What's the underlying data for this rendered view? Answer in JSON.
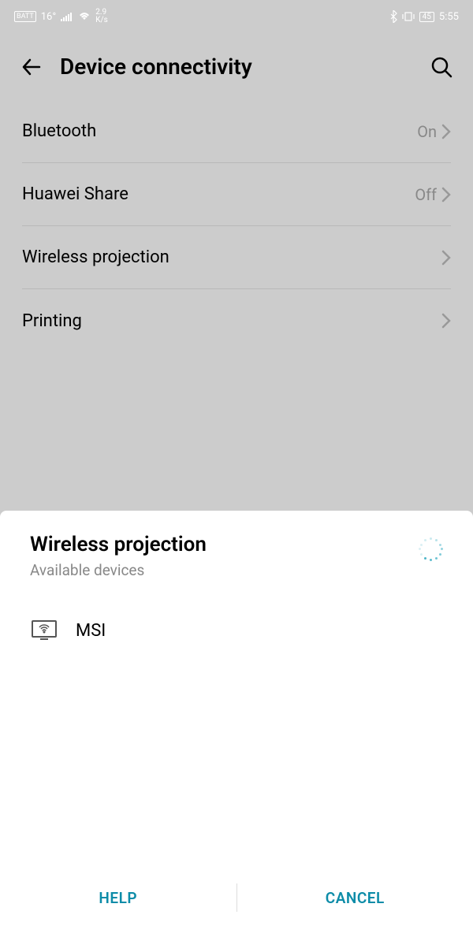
{
  "status": {
    "temp": "16°",
    "speed_top": "2.9",
    "speed_unit": "K/s",
    "battery": "45",
    "time": "5:55"
  },
  "header": {
    "title": "Device connectivity"
  },
  "settings": [
    {
      "label": "Bluetooth",
      "value": "On",
      "has_chevron": true
    },
    {
      "label": "Huawei Share",
      "value": "Off",
      "has_chevron": true
    },
    {
      "label": "Wireless projection",
      "value": "",
      "has_chevron": true
    },
    {
      "label": "Printing",
      "value": "",
      "has_chevron": true
    }
  ],
  "sheet": {
    "title": "Wireless projection",
    "subtitle": "Available devices",
    "devices": [
      {
        "name": "MSI"
      }
    ],
    "help_label": "HELP",
    "cancel_label": "CANCEL"
  }
}
